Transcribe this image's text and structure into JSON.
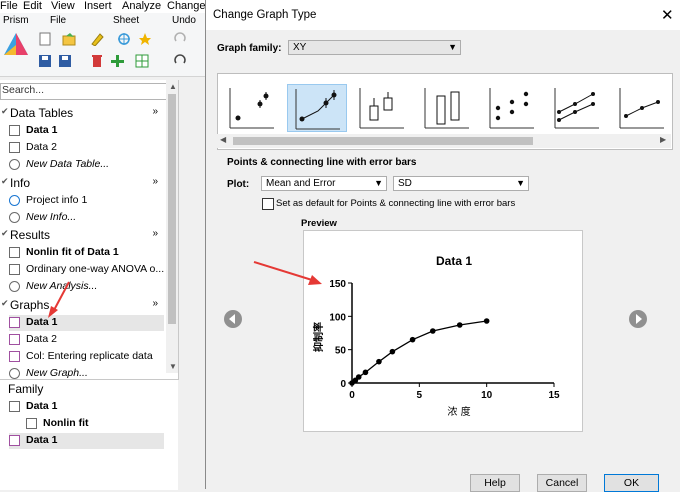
{
  "menu": {
    "items": [
      "File",
      "Edit",
      "View",
      "Insert",
      "Analyze",
      "Change"
    ]
  },
  "ribbon": {
    "groups": [
      "Prism",
      "File",
      "Sheet",
      "Undo"
    ]
  },
  "search": {
    "placeholder": "Search..."
  },
  "navigator": {
    "sections": [
      {
        "label": "Data Tables",
        "items": [
          {
            "label": "Data 1",
            "style": "bold"
          },
          {
            "label": "Data 2",
            "style": "normal"
          },
          {
            "label": "New Data Table...",
            "style": "italic"
          }
        ]
      },
      {
        "label": "Info",
        "items": [
          {
            "label": "Project info 1",
            "style": "normal"
          },
          {
            "label": "New Info...",
            "style": "italic"
          }
        ]
      },
      {
        "label": "Results",
        "items": [
          {
            "label": "Nonlin fit of Data 1",
            "style": "bold"
          },
          {
            "label": "Ordinary one-way ANOVA o...",
            "style": "normal"
          },
          {
            "label": "New Analysis...",
            "style": "italic"
          }
        ]
      },
      {
        "label": "Graphs",
        "items": [
          {
            "label": "Data 1",
            "style": "bold"
          },
          {
            "label": "Data 2",
            "style": "normal"
          },
          {
            "label": "Col: Entering replicate data",
            "style": "normal"
          },
          {
            "label": "New Graph...",
            "style": "italic"
          }
        ]
      }
    ],
    "chevron": "»"
  },
  "family": {
    "label": "Family",
    "items": [
      {
        "label": "Data 1"
      },
      {
        "label": "Nonlin fit"
      },
      {
        "label": "Data 1"
      }
    ]
  },
  "dialog": {
    "title": "Change Graph Type",
    "graph_family_label": "Graph family:",
    "graph_family_value": "XY",
    "type_caption": "Points & connecting line with error bars",
    "plot_label": "Plot:",
    "plot_value": "Mean and Error",
    "error_value": "SD",
    "default_checkbox_label": "Set as default for Points & connecting line with error bars",
    "default_checked": false,
    "preview_label": "Preview",
    "buttons": {
      "help": "Help",
      "cancel": "Cancel",
      "ok": "OK"
    }
  },
  "chart_data": {
    "type": "scatter",
    "title": "Data 1",
    "xlabel": "浓 度",
    "ylabel": "抑制率",
    "xlim": [
      0,
      15
    ],
    "ylim": [
      0,
      150
    ],
    "xticks": [
      0,
      5,
      10,
      15
    ],
    "yticks": [
      0,
      50,
      100,
      150
    ],
    "x": [
      0,
      0.25,
      0.5,
      1,
      2,
      3,
      4.5,
      6,
      8,
      10
    ],
    "y": [
      0,
      4,
      9,
      16,
      32,
      47,
      65,
      78,
      87,
      93
    ],
    "connect_line": true,
    "grid": false
  }
}
